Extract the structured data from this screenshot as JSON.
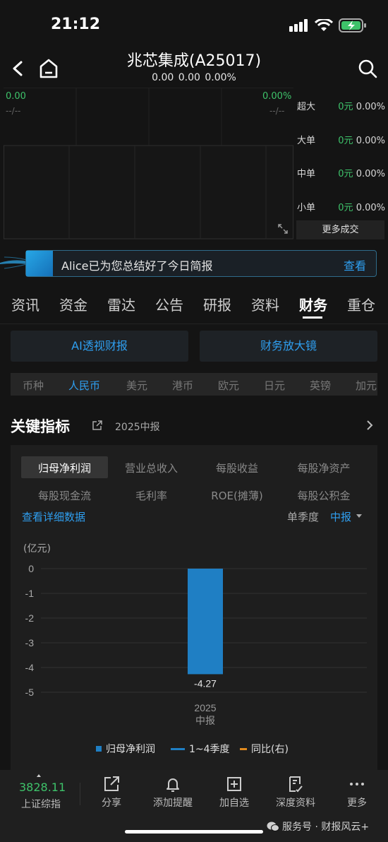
{
  "status": {
    "time": "21:12"
  },
  "header": {
    "title": "兆芯集成(A25017)",
    "subtitle": "0.00  0.00  0.00%"
  },
  "mini_chart": {
    "left_value": "0.00",
    "right_value": "0.00%",
    "left_dash": "--/--",
    "right_dash": "--/--"
  },
  "order_flow": [
    {
      "label": "超大",
      "value": "0元",
      "pct": "0.00%"
    },
    {
      "label": "大单",
      "value": "0元",
      "pct": "0.00%"
    },
    {
      "label": "中单",
      "value": "0元",
      "pct": "0.00%"
    },
    {
      "label": "小单",
      "value": "0元",
      "pct": "0.00%"
    }
  ],
  "more_trade": "更多成交",
  "alice": {
    "text": "Alice已为您总结好了今日简报",
    "button": "查看"
  },
  "tabs": [
    "资讯",
    "资金",
    "雷达",
    "公告",
    "研报",
    "资料",
    "财务",
    "重仓"
  ],
  "active_tab": "财务",
  "buttons": {
    "ai": "AI透视财报",
    "magnifier": "财务放大镜"
  },
  "currencies": [
    "币种",
    "人民币",
    "美元",
    "港币",
    "欧元",
    "日元",
    "英镑",
    "加元"
  ],
  "active_currency": "人民币",
  "key_indicators": {
    "title": "关键指标",
    "period": "2025中报"
  },
  "indicators_row1": [
    "归母净利润",
    "营业总收入",
    "每股收益",
    "每股净资产"
  ],
  "indicators_row2": [
    "每股现金流",
    "毛利率",
    "ROE(摊薄)",
    "每股公积金"
  ],
  "active_indicator": "归母净利润",
  "detail_link": "查看详细数据",
  "quarter_label": "单季度",
  "interim_label": "中报",
  "chart_data": {
    "type": "bar",
    "unit_label": "(亿元)",
    "categories": [
      "2025\n中报"
    ],
    "category_lines": [
      "2025",
      "中报"
    ],
    "series": [
      {
        "name": "归母净利润",
        "values": [
          -4.27
        ]
      }
    ],
    "data_labels": [
      "-4.27"
    ],
    "y_ticks": [
      "0",
      "-1",
      "-2",
      "-3",
      "-4",
      "-5"
    ],
    "ylim": [
      -5,
      0
    ],
    "grid": true,
    "legend": [
      "归母净利润",
      "1~4季度",
      "同比(右)"
    ],
    "legend_colors": [
      "#1f7fc4",
      "#1f7fc4",
      "#e08a1e"
    ]
  },
  "bottom_nav": {
    "index_value": "3828.11",
    "index_name": "上证综指",
    "items": [
      "分享",
      "添加提醒",
      "加自选",
      "深度资料",
      "更多"
    ]
  },
  "watermark": "服务号 · 财报风云+"
}
